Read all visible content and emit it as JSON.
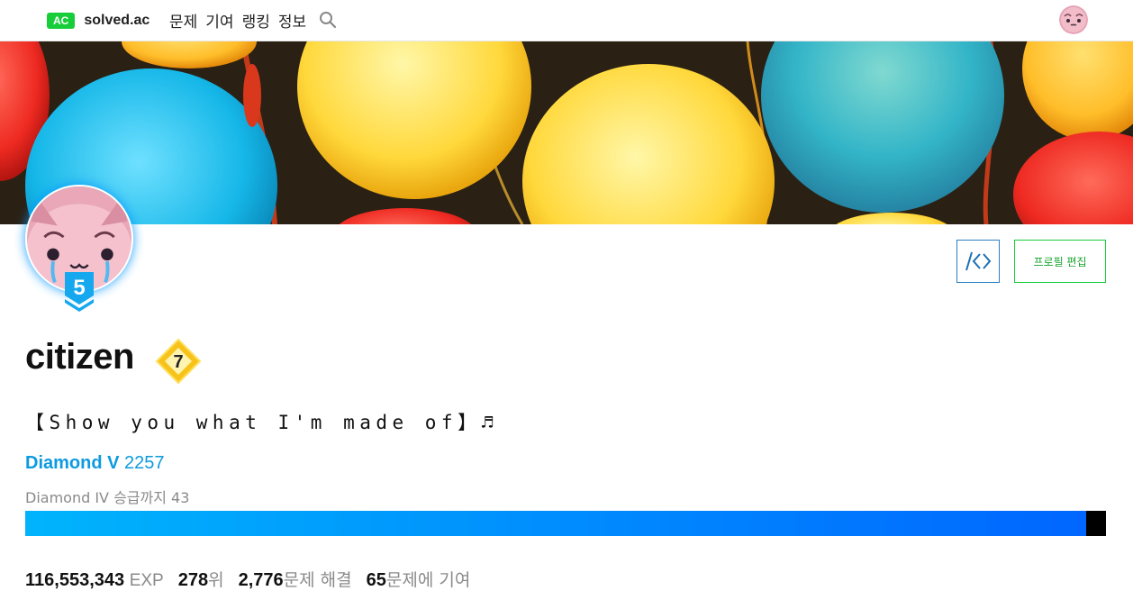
{
  "nav": {
    "logo_badge": "AC",
    "logo_text": "solved.ac",
    "items": [
      "문제",
      "기여",
      "랭킹",
      "정보"
    ],
    "search_icon": "search-icon",
    "avatar_icon": "user-avatar"
  },
  "banner": {
    "icon": "balloons-banner-image"
  },
  "profile": {
    "handle": "citizen",
    "tier_badge_level": "5",
    "class_badge_level": "7",
    "bio": "【Show you what I'm made of】♬",
    "tier_name": "Diamond V",
    "rating": "2257",
    "next_tier": "Diamond IV 승급까지 43",
    "progress_fraction": 0.9817
  },
  "buttons": {
    "code_label": "/<>",
    "edit_label": "프로필 편집"
  },
  "stats": {
    "exp_value": "116,553,343",
    "exp_unit": "EXP",
    "rank_value": "278",
    "rank_unit": "위",
    "solved_value": "2,776",
    "solved_unit": "문제 해결",
    "contrib_value": "65",
    "contrib_unit": "문제에 기여"
  },
  "colors": {
    "brand_green": "#17ce3a",
    "diamond_blue": "#0d9ae0",
    "progress_start": "#00b4fc",
    "progress_end": "#0066ff",
    "muted_text": "#8a8a8a"
  }
}
